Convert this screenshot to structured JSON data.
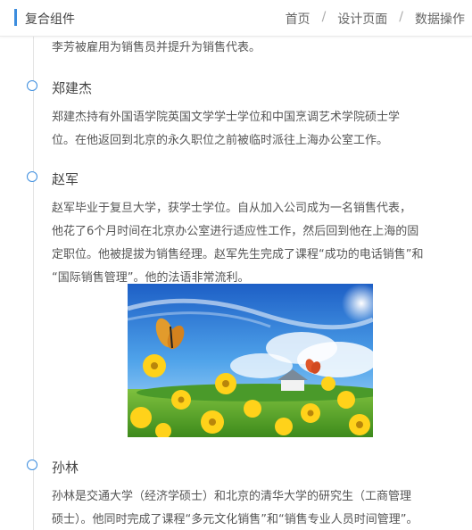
{
  "header": {
    "title": "复合组件",
    "breadcrumb": [
      "首页",
      "设计页面",
      "数据操作"
    ],
    "separator": "/"
  },
  "timeline": {
    "top_text": "李芳被雇用为销售员并提升为销售代表。",
    "entries": [
      {
        "name": "郑建杰",
        "lines": [
          "郑建杰持有外国语学院英国文学学士学位和中国烹调艺术学院硕士学",
          "位。在他返回到北京的永久职位之前被临时派往上海办公室工作。"
        ]
      },
      {
        "name": "赵军",
        "lines": [
          "赵军毕业于复旦大学，获学士学位。自从加入公司成为一名销售代表，",
          "他花了6个月时间在北京办公室进行适应性工作，然后回到他在上海的固",
          "定职位。他被提拔为销售经理。赵军先生完成了课程“成功的电话销售”和",
          "“国际销售管理”。他的法语非常流利。"
        ]
      },
      {
        "name": "孙林",
        "lines": [
          "孙林是交通大学（经济学硕士）和北京的清华大学的研究生（工商管理",
          "硕士）。他同时完成了课程“多元文化销售”和“销售专业人员时间管理”。"
        ]
      }
    ]
  },
  "colors": {
    "accent": "#3c8dde",
    "line": "#e4e4e4"
  }
}
